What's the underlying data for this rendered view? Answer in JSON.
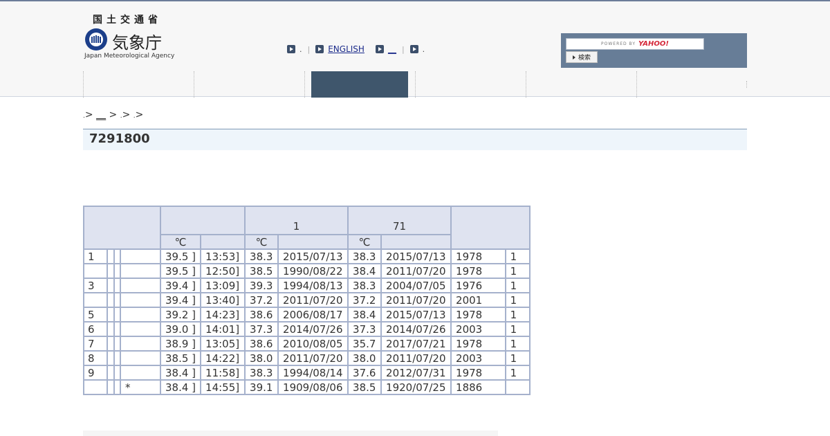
{
  "logo": {
    "top_text": "国土交通省",
    "name": "気象庁",
    "english": "Japan Meteorological Agency"
  },
  "util_links": [
    {
      "label": "",
      "trail": ".",
      "is_link": false
    },
    {
      "label": "ENGLISH",
      "trail": "",
      "is_link": true
    },
    {
      "label": "__",
      "trail": "",
      "is_link": true
    },
    {
      "label": "",
      "trail": ".",
      "is_link": false
    }
  ],
  "search": {
    "powered_by": "POWERED BY",
    "brand": "YAHOO!",
    "button_label": "検索"
  },
  "global_nav": {
    "items": 6,
    "active_index": 2
  },
  "breadcrumb": {
    "first_dot": ".",
    "sep": ">",
    "link": "__",
    "mid_dot": ".",
    "last_dot": "."
  },
  "page_title": "7291800",
  "table": {
    "header": {
      "group1": "",
      "group2": "1",
      "group3": "71",
      "unit1": "℃",
      "unit2": "℃",
      "unit3": "℃"
    },
    "rows": [
      [
        "1",
        "",
        "",
        "",
        "39.5 ]",
        "13:53]",
        "38.3",
        "2015/07/13",
        "38.3",
        "2015/07/13",
        "1978",
        "1"
      ],
      [
        "",
        "",
        "",
        "",
        "39.5 ]",
        "12:50]",
        "38.5",
        "1990/08/22",
        "38.4",
        "2011/07/20",
        "1978",
        "1"
      ],
      [
        "3",
        "",
        "",
        "",
        "39.4 ]",
        "13:09]",
        "39.3",
        "1994/08/13",
        "38.3",
        "2004/07/05",
        "1976",
        "1"
      ],
      [
        "",
        "",
        "",
        "",
        "39.4 ]",
        "13:40]",
        "37.2",
        "2011/07/20",
        "37.2",
        "2011/07/20",
        "2001",
        "1"
      ],
      [
        "5",
        "",
        "",
        "",
        "39.2 ]",
        "14:23]",
        "38.6",
        "2006/08/17",
        "38.4",
        "2015/07/13",
        "1978",
        "1"
      ],
      [
        "6",
        "",
        "",
        "",
        "39.0 ]",
        "14:01]",
        "37.3",
        "2014/07/26",
        "37.3",
        "2014/07/26",
        "2003",
        "1"
      ],
      [
        "7",
        "",
        "",
        "",
        "38.9 ]",
        "13:05]",
        "38.6",
        "2010/08/05",
        "35.7",
        "2017/07/21",
        "1978",
        "1"
      ],
      [
        "8",
        "",
        "",
        "",
        "38.5 ]",
        "14:22]",
        "38.0",
        "2011/07/20",
        "38.0",
        "2011/07/20",
        "2003",
        "1"
      ],
      [
        "9",
        "",
        "",
        "",
        "38.4 ]",
        "11:58]",
        "38.3",
        "1994/08/14",
        "37.6",
        "2012/07/31",
        "1978",
        "1"
      ],
      [
        "",
        "",
        "",
        "*",
        "38.4 ]",
        "14:55]",
        "39.1",
        "1909/08/06",
        "38.5",
        "1920/07/25",
        "1886",
        ""
      ]
    ]
  },
  "colors": {
    "header_bg": "#f7f7f7",
    "nav_active": "#3f566c",
    "search_bg": "#677d97",
    "table_header_bg": "#dfe3f0",
    "table_border": "#a5b1cc",
    "title_bar_bg": "#eef5fb"
  },
  "icons": {
    "util_bullet": "play-square-icon",
    "search_button": "triangle-right-icon"
  }
}
